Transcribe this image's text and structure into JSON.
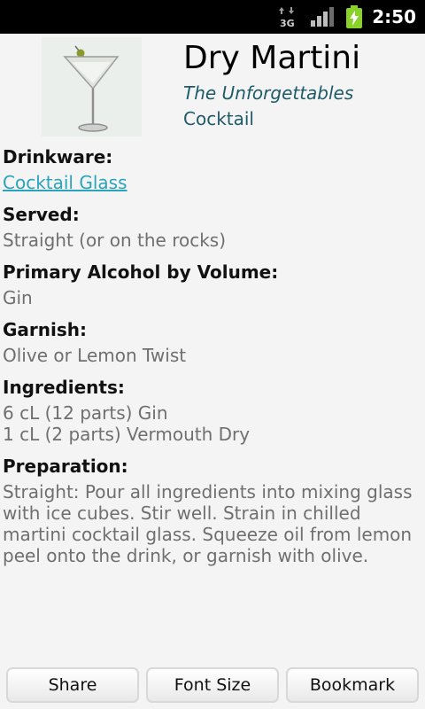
{
  "status_bar": {
    "network_label": "3G",
    "time": "2:50",
    "icons": [
      "3g-data-icon",
      "signal-icon",
      "battery-charging-icon"
    ]
  },
  "drink": {
    "name": "Dry Martini",
    "subtitle": "The Unforgettables",
    "category": "Cocktail",
    "image_icon": "martini-glass-image"
  },
  "details": {
    "drinkware_label": "Drinkware:",
    "drinkware_value": "Cocktail Glass",
    "served_label": "Served:",
    "served_value": "Straight (or on the rocks)",
    "alcohol_label": "Primary Alcohol by Volume:",
    "alcohol_value": "Gin",
    "garnish_label": "Garnish:",
    "garnish_value": "Olive or Lemon Twist",
    "ingredients_label": "Ingredients:",
    "ingredients": [
      "6 cL (12 parts) Gin",
      "1 cL (2 parts) Vermouth Dry"
    ],
    "preparation_label": "Preparation:",
    "preparation_value": "Straight: Pour all ingredients into mixing glass with ice cubes. Stir well. Strain in chilled martini cocktail glass. Squeeze oil from lemon peel onto the drink, or garnish with olive."
  },
  "buttons": {
    "share": "Share",
    "font_size": "Font Size",
    "bookmark": "Bookmark"
  },
  "colors": {
    "link": "#2aa3bd",
    "accent_text": "#1f5a68",
    "value_text": "#6f6f6f"
  }
}
